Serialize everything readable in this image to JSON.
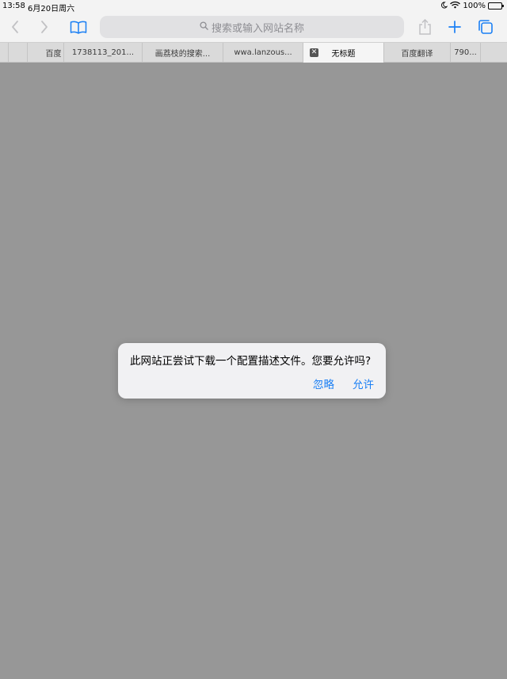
{
  "status_bar": {
    "time": "13:58",
    "date": "6月20日周六",
    "battery": "100%",
    "icons": [
      "moon-icon",
      "wifi-icon",
      "battery-icon"
    ]
  },
  "toolbar": {
    "search_placeholder": "搜索或输入网站名称",
    "buttons": [
      "back-icon",
      "forward-icon",
      "bookmarks-icon",
      "share-icon",
      "new-tab-icon",
      "tabs-overview-icon"
    ],
    "accent_color": "#1a7ff4"
  },
  "tabs": [
    {
      "label": "百度"
    },
    {
      "label": "1738113_201..."
    },
    {
      "label": "画荔枝的搜索..."
    },
    {
      "label": "wwa.lanzous..."
    },
    {
      "label": "无标题",
      "active": true
    },
    {
      "label": "百度翻译"
    },
    {
      "label": "790..."
    }
  ],
  "alert": {
    "message": "此网站正尝试下载一个配置描述文件。您要允许吗?",
    "ignore_label": "忽略",
    "allow_label": "允许"
  }
}
